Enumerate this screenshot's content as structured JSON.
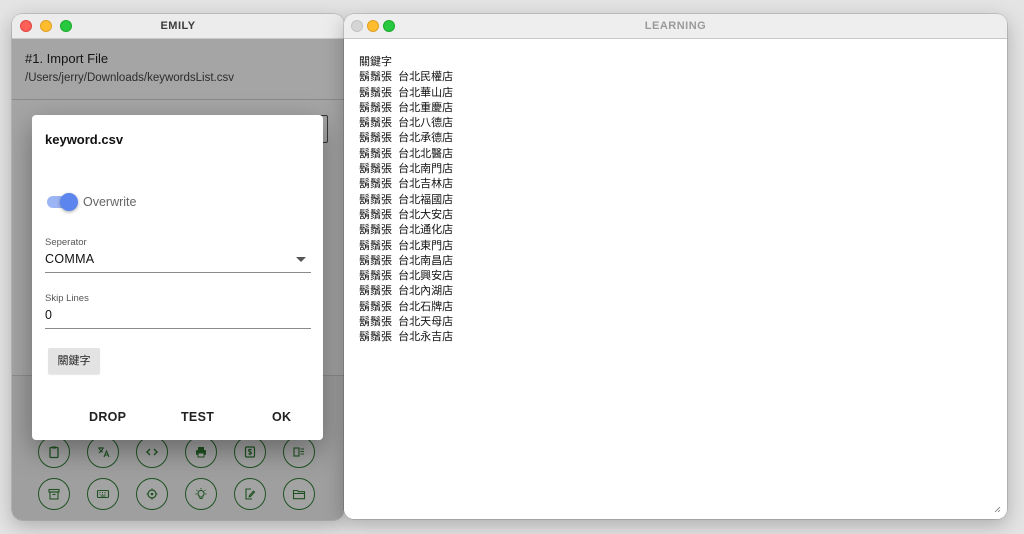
{
  "emily_window": {
    "title": "EMILY",
    "section_title": "#1. Import File",
    "file_path": "/Users/jerry/Downloads/keywordsList.csv"
  },
  "dialog": {
    "title": "keyword.csv",
    "overwrite_label": "Overwrite",
    "overwrite_on": true,
    "separator_label": "Seperator",
    "separator_value": "COMMA",
    "skip_lines_label": "Skip Lines",
    "skip_lines_value": "0",
    "chip_label": "關鍵字",
    "actions": {
      "drop": "DROP",
      "test": "TEST",
      "ok": "OK"
    }
  },
  "learning_window": {
    "title": "LEARNING",
    "lines": [
      "關鍵字",
      "鬍鬚張  台北民權店",
      "鬍鬚張  台北華山店",
      "鬍鬚張  台北重慶店",
      "鬍鬚張  台北八德店",
      "鬍鬚張  台北承德店",
      "鬍鬚張  台北北醫店",
      "鬍鬚張  台北南門店",
      "鬍鬚張  台北吉林店",
      "鬍鬚張  台北福國店",
      "鬍鬚張  台北大安店",
      "鬍鬚張  台北通化店",
      "鬍鬚張  台北東門店",
      "鬍鬚張  台北南昌店",
      "鬍鬚張  台北興安店",
      "鬍鬚張  台北內湖店",
      "鬍鬚張  台北石牌店",
      "鬍鬚張  台北天母店",
      "鬍鬚張  台北永吉店"
    ]
  },
  "icons": {
    "row1": [
      "clipboard-icon",
      "translate-icon",
      "code-icon",
      "print-icon",
      "currency-icon",
      "list-detail-icon"
    ],
    "row2": [
      "archive-icon",
      "keyboard-icon",
      "crosshair-icon",
      "lightbulb-icon",
      "edit-document-icon",
      "folder-open-icon"
    ]
  },
  "colors": {
    "accent_green": "#2e7d32",
    "switch_blue": "#5c86ee",
    "close_red": "#fe5f57",
    "minimize_yellow": "#febc2e",
    "zoom_green": "#28c840"
  }
}
